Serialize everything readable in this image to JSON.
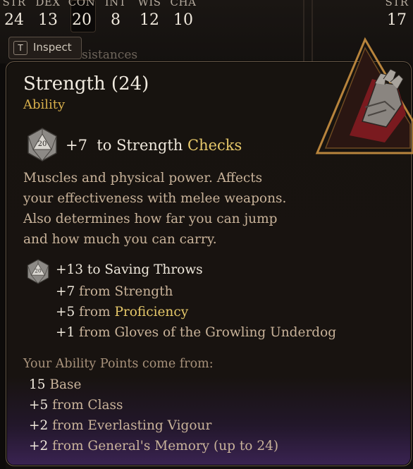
{
  "stats_bar": {
    "stats": [
      {
        "label": "STR",
        "value": "24"
      },
      {
        "label": "DEX",
        "value": "13"
      },
      {
        "label": "CON",
        "value": "20"
      },
      {
        "label": "INT",
        "value": "8"
      },
      {
        "label": "WIS",
        "value": "12"
      },
      {
        "label": "CHA",
        "value": "10"
      }
    ],
    "right_stat": {
      "label": "STR",
      "value": "17"
    }
  },
  "inspect_button": {
    "key": "T",
    "label": "Inspect"
  },
  "background_text": "sistances",
  "tooltip": {
    "title": "Strength (24)",
    "subtitle": "Ability",
    "check": {
      "bonus": "+7",
      "text": "to Strength",
      "highlight": "Checks",
      "die_label": "20"
    },
    "description": "Muscles and physical power. Affects your effectiveness with melee weapons. Also determines how far you can jump and how much you can carry.",
    "saving_throws": {
      "header": "+13 to Saving Throws",
      "die_label": "20",
      "items": [
        {
          "num": "+7",
          "prefix": "from",
          "source": "Strength",
          "highlight": false
        },
        {
          "num": "+5",
          "prefix": "from",
          "source": "Proficiency",
          "highlight": true
        },
        {
          "num": "+1",
          "prefix": "from",
          "source": "Gloves of the Growling Underdog",
          "highlight": false
        }
      ]
    },
    "points_header": "Your Ability Points come from:",
    "points": [
      {
        "num": "15",
        "text": "Base"
      },
      {
        "num": "+5",
        "text": "from Class"
      },
      {
        "num": "+2",
        "text": "from Everlasting Vigour"
      },
      {
        "num": "+2",
        "text": "from General's Memory (up to 24)"
      }
    ]
  },
  "colors": {
    "gold": "#e6c86a",
    "body_text": "#c9b39a",
    "panel_border": "#6a5a48"
  },
  "icons": [
    "d20-die-icon",
    "gauntlet-icon"
  ]
}
